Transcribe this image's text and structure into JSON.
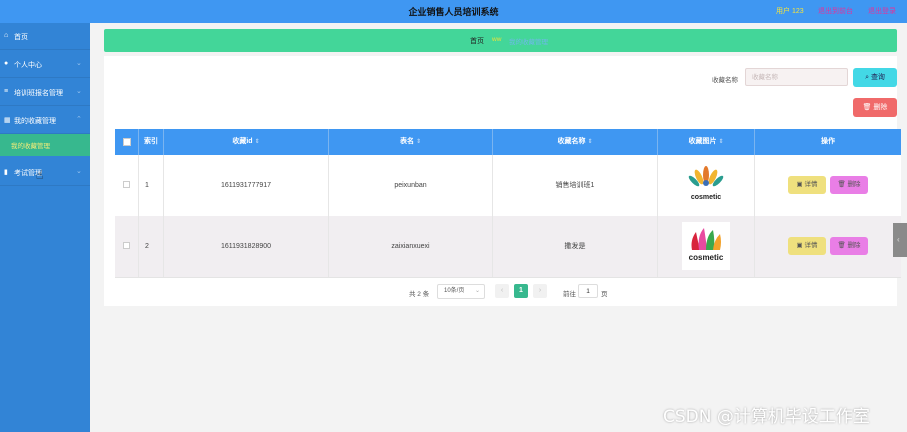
{
  "header": {
    "title": "企业销售人员培训系统",
    "user": "用户 123",
    "back_link": "退出到前台",
    "logout_link": "退出登录"
  },
  "sidebar": {
    "items": [
      {
        "label": "首页",
        "icon": "home-icon"
      },
      {
        "label": "个人中心",
        "icon": "user-icon"
      },
      {
        "label": "培训班报名管理",
        "icon": "menu-icon"
      },
      {
        "label": "我的收藏管理",
        "icon": "grid-icon"
      },
      {
        "label": "考试管理",
        "icon": "chart-icon"
      }
    ],
    "sub_item": "我的收藏管理"
  },
  "breadcrumb": {
    "home": "首页",
    "current": "ww",
    "current_detail": "我的收藏管理"
  },
  "search": {
    "label": "收藏名称",
    "placeholder": "收藏名称",
    "query_button": "查询",
    "delete_button": "删除"
  },
  "table": {
    "columns": [
      "索引",
      "收藏id",
      "表名",
      "收藏名称",
      "收藏图片",
      "操作"
    ],
    "rows": [
      {
        "index": "1",
        "id": "1611931777917",
        "table": "peixunban",
        "name": "销售培训班1",
        "image": "cosmetic-logo-peacock"
      },
      {
        "index": "2",
        "id": "1611931828900",
        "table": "zaixianxuexi",
        "name": "撒发是",
        "image": "cosmetic-logo-flame"
      }
    ],
    "detail_button": "详情",
    "delete_button": "删除"
  },
  "pagination": {
    "total": "共 2 条",
    "page_size": "10条/页",
    "current_page": "1",
    "goto_label": "前往",
    "goto_value": "1",
    "page_label": "页"
  },
  "logo_text": "cosmetic",
  "watermark": "CSDN @计算机毕设工作室",
  "colors": {
    "header": "#3f97f2",
    "sidebar": "#3284d6",
    "accent_green": "#43d699",
    "active_sub": "#37b88e",
    "query_button": "#43d8e6",
    "delete_button": "#f06a6a",
    "detail_button": "#efe07e",
    "row_delete_button": "#e97ee6"
  }
}
